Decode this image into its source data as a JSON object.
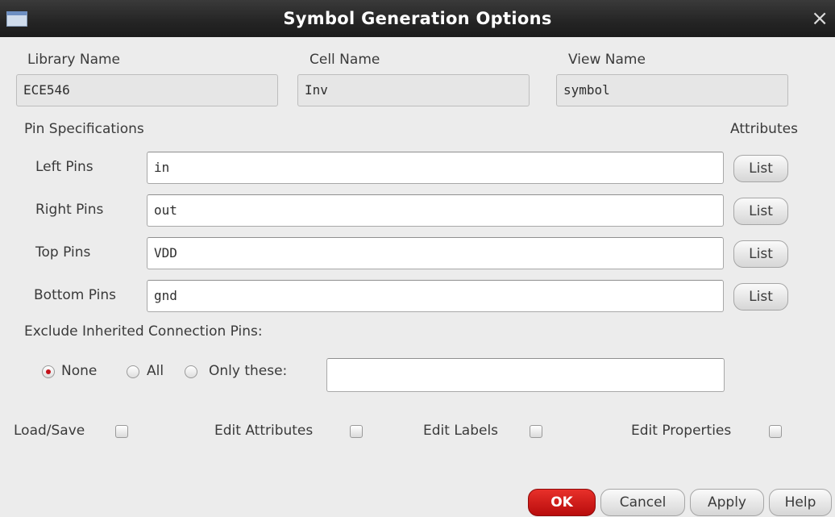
{
  "window": {
    "title": "Symbol Generation Options",
    "close_glyph": "×",
    "icon": "window-icon"
  },
  "names": {
    "library_label": "Library Name",
    "library_value": "ECE546",
    "cell_label": "Cell Name",
    "cell_value": "Inv",
    "view_label": "View Name",
    "view_value": "symbol"
  },
  "pins": {
    "heading": "Pin Specifications",
    "attributes_label": "Attributes",
    "rows": [
      {
        "label": "Left Pins",
        "value": "in",
        "button": "List"
      },
      {
        "label": "Right Pins",
        "value": "out",
        "button": "List"
      },
      {
        "label": "Top Pins",
        "value": "VDD",
        "button": "List"
      },
      {
        "label": "Bottom Pins",
        "value": "gnd",
        "button": "List"
      }
    ]
  },
  "exclude": {
    "label": "Exclude Inherited Connection Pins:",
    "options": [
      "None",
      "All",
      "Only these:"
    ],
    "selected": "None",
    "only_these_value": ""
  },
  "checks": [
    {
      "label": "Load/Save",
      "checked": false
    },
    {
      "label": "Edit Attributes",
      "checked": false
    },
    {
      "label": "Edit Labels",
      "checked": false
    },
    {
      "label": "Edit Properties",
      "checked": false
    }
  ],
  "buttons": {
    "ok": "OK",
    "cancel": "Cancel",
    "apply": "Apply",
    "help": "Help"
  },
  "colors": {
    "titlebar": "#2b2b2b",
    "ok_button": "#cc1515",
    "dialog_bg": "#ececec"
  }
}
